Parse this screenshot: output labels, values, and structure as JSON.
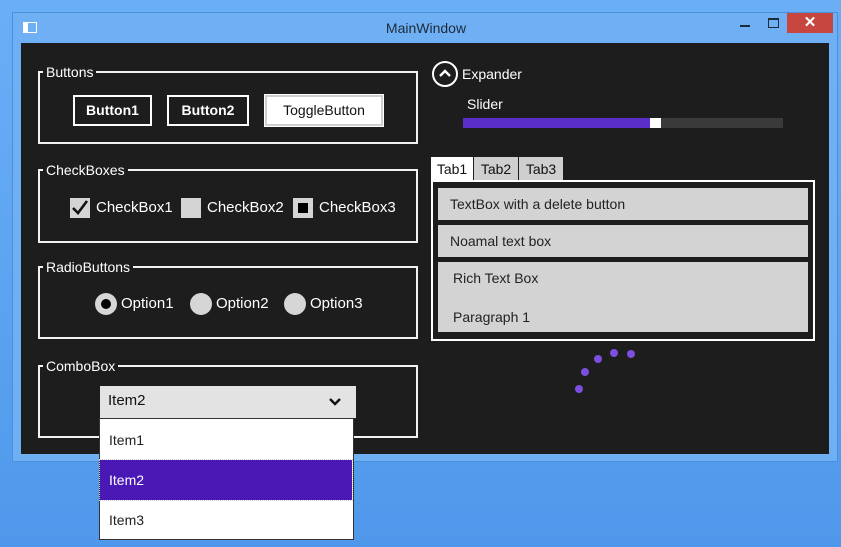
{
  "window": {
    "title": "MainWindow",
    "close_label": "✕"
  },
  "buttons_group": {
    "label": "Buttons",
    "button1": "Button1",
    "button2": "Button2",
    "toggle": "ToggleButton"
  },
  "checkboxes_group": {
    "label": "CheckBoxes",
    "items": [
      {
        "label": "CheckBox1",
        "state": "checked"
      },
      {
        "label": "CheckBox2",
        "state": "unchecked"
      },
      {
        "label": "CheckBox3",
        "state": "indeterminate"
      }
    ]
  },
  "radio_group": {
    "label": "RadioButtons",
    "items": [
      {
        "label": "Option1",
        "selected": true
      },
      {
        "label": "Option2",
        "selected": false
      },
      {
        "label": "Option3",
        "selected": false
      }
    ]
  },
  "combobox_group": {
    "label": "ComboBox",
    "selected": "Item2",
    "options": [
      "Item1",
      "Item2",
      "Item3"
    ]
  },
  "expander": {
    "label": "Expander"
  },
  "slider": {
    "label": "Slider",
    "value_fraction": 0.6
  },
  "tabs": {
    "items": [
      "Tab1",
      "Tab2",
      "Tab3"
    ],
    "active": "Tab1",
    "textbox_delete": "TextBox with a delete button",
    "textbox_normal": "Noamal text box",
    "richtext_line1": "Rich Text Box",
    "richtext_line2": "Paragraph 1"
  },
  "colors": {
    "accent": "#5a2ec9",
    "selection": "#4a19b5",
    "close_button": "#c7463f",
    "window_frame": "#6fb0f5",
    "client_background": "#1d1d1d"
  },
  "icons": {
    "app": "window-icon",
    "expander": "chevron-up-circle-icon",
    "combo_arrow": "chevron-down-icon",
    "check": "checkmark-icon",
    "progress": "progress-ring-icon"
  }
}
